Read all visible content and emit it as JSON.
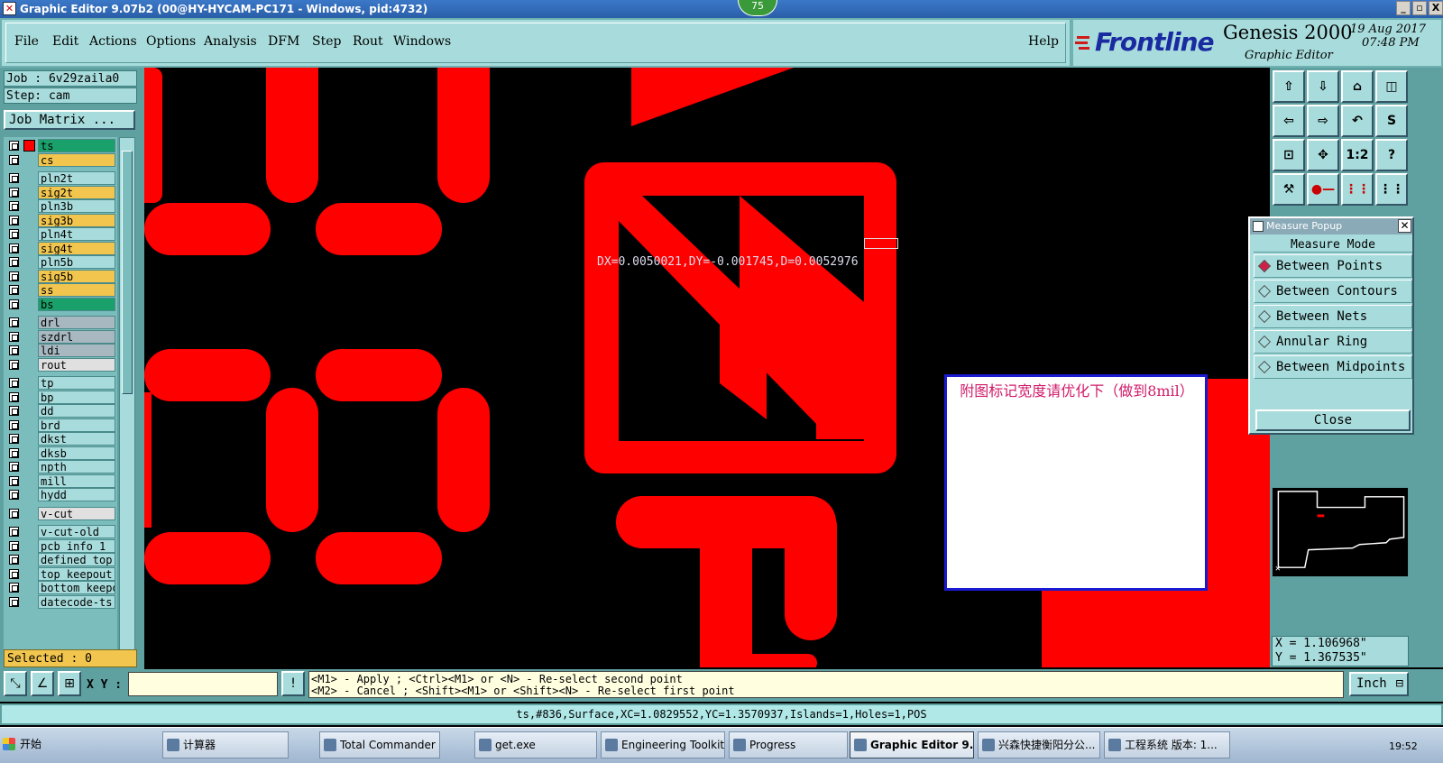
{
  "window": {
    "title": "Graphic Editor 9.07b2 (00@HY-HYCAM-PC171 - Windows, pid:4732)",
    "badge": "75",
    "controls": [
      "_",
      "▫",
      "X"
    ]
  },
  "menu": {
    "items": [
      "File",
      "Edit",
      "Actions",
      "Options",
      "Analysis",
      "DFM",
      "Step",
      "Rout",
      "Windows"
    ],
    "help": "Help"
  },
  "branding": {
    "logo": "Frontline",
    "product": "Genesis 2000",
    "subtitle": "Graphic Editor",
    "date": "19 Aug 2017",
    "time": "07:48 PM"
  },
  "job": {
    "job_label": "Job : 6v29zaila0",
    "step_label": "Step: cam",
    "matrix_button": "Job Matrix ..."
  },
  "layers": [
    {
      "name": "ts",
      "color": "#1aa06a"
    },
    {
      "name": "cs",
      "color": "#f2c64e"
    },
    {
      "name": "pln2t",
      "color": "#a8dcdc"
    },
    {
      "name": "sig2t",
      "color": "#f2c64e"
    },
    {
      "name": "pln3b",
      "color": "#a8dcdc"
    },
    {
      "name": "sig3b",
      "color": "#f2c64e"
    },
    {
      "name": "pln4t",
      "color": "#a8dcdc"
    },
    {
      "name": "sig4t",
      "color": "#f2c64e"
    },
    {
      "name": "pln5b",
      "color": "#a8dcdc"
    },
    {
      "name": "sig5b",
      "color": "#f2c64e"
    },
    {
      "name": "ss",
      "color": "#f2c64e"
    },
    {
      "name": "bs",
      "color": "#1aa06a"
    },
    {
      "name": "drl",
      "color": "#a8b8c0"
    },
    {
      "name": "szdrl",
      "color": "#a8b8c0"
    },
    {
      "name": "ldi",
      "color": "#a8b8c0"
    },
    {
      "name": "rout",
      "color": "#e0e0e0"
    },
    {
      "name": "tp",
      "color": "#a8dcdc"
    },
    {
      "name": "bp",
      "color": "#a8dcdc"
    },
    {
      "name": "dd",
      "color": "#a8dcdc"
    },
    {
      "name": "brd",
      "color": "#a8dcdc"
    },
    {
      "name": "dkst",
      "color": "#a8dcdc"
    },
    {
      "name": "dksb",
      "color": "#a8dcdc"
    },
    {
      "name": "npth",
      "color": "#a8dcdc"
    },
    {
      "name": "mill",
      "color": "#a8dcdc"
    },
    {
      "name": "hydd",
      "color": "#a8dcdc"
    },
    {
      "name": "v-cut",
      "color": "#e0e0e0"
    },
    {
      "name": "v-cut-old",
      "color": "#a8dcdc"
    },
    {
      "name": "pcb_info_1",
      "color": "#a8dcdc"
    },
    {
      "name": "defined_top",
      "color": "#a8dcdc"
    },
    {
      "name": "top_keepout",
      "color": "#a8dcdc"
    },
    {
      "name": "bottom_keepo",
      "color": "#a8dcdc"
    },
    {
      "name": "datecode-ts",
      "color": "#a8dcdc"
    }
  ],
  "selected": "Selected : 0",
  "canvas": {
    "measure_readout": "DX=0.0050021,DY=-0.001745,D=0.0052976",
    "note": "附图标记宽度请优化下（做到8mil）"
  },
  "measure_popup": {
    "title": "Measure Popup",
    "header": "Measure Mode",
    "options": [
      "Between Points",
      "Between Contours",
      "Between Nets",
      "Annular Ring",
      "Between Midpoints"
    ],
    "selected_option": "Between Points",
    "close": "Close"
  },
  "coords": {
    "x": "X = 1.106968\"",
    "y": "Y = 1.367535\""
  },
  "command": {
    "xy_label": "X Y :",
    "xy_value": "",
    "help_line1": "<M1> - Apply  ; <Ctrl><M1> or <N> - Re-select second point",
    "help_line2": "<M2> - Cancel ; <Shift><M1> or <Shift><N> - Re-select first point",
    "units": "Inch"
  },
  "status": "ts,#836,Surface,XC=1.0829552,YC=1.3570937,Islands=1,Holes=1,POS",
  "taskbar": {
    "start": "开始",
    "items": [
      "计算器",
      "Total Commander 7....",
      "get.exe",
      "Engineering Toolkit 9...",
      "Progress",
      "Graphic Editor 9.0...",
      "兴森快捷衡阳分公...",
      "工程系统  版本: 1..."
    ],
    "active": "Graphic Editor 9.0...",
    "clock": "19:52"
  }
}
